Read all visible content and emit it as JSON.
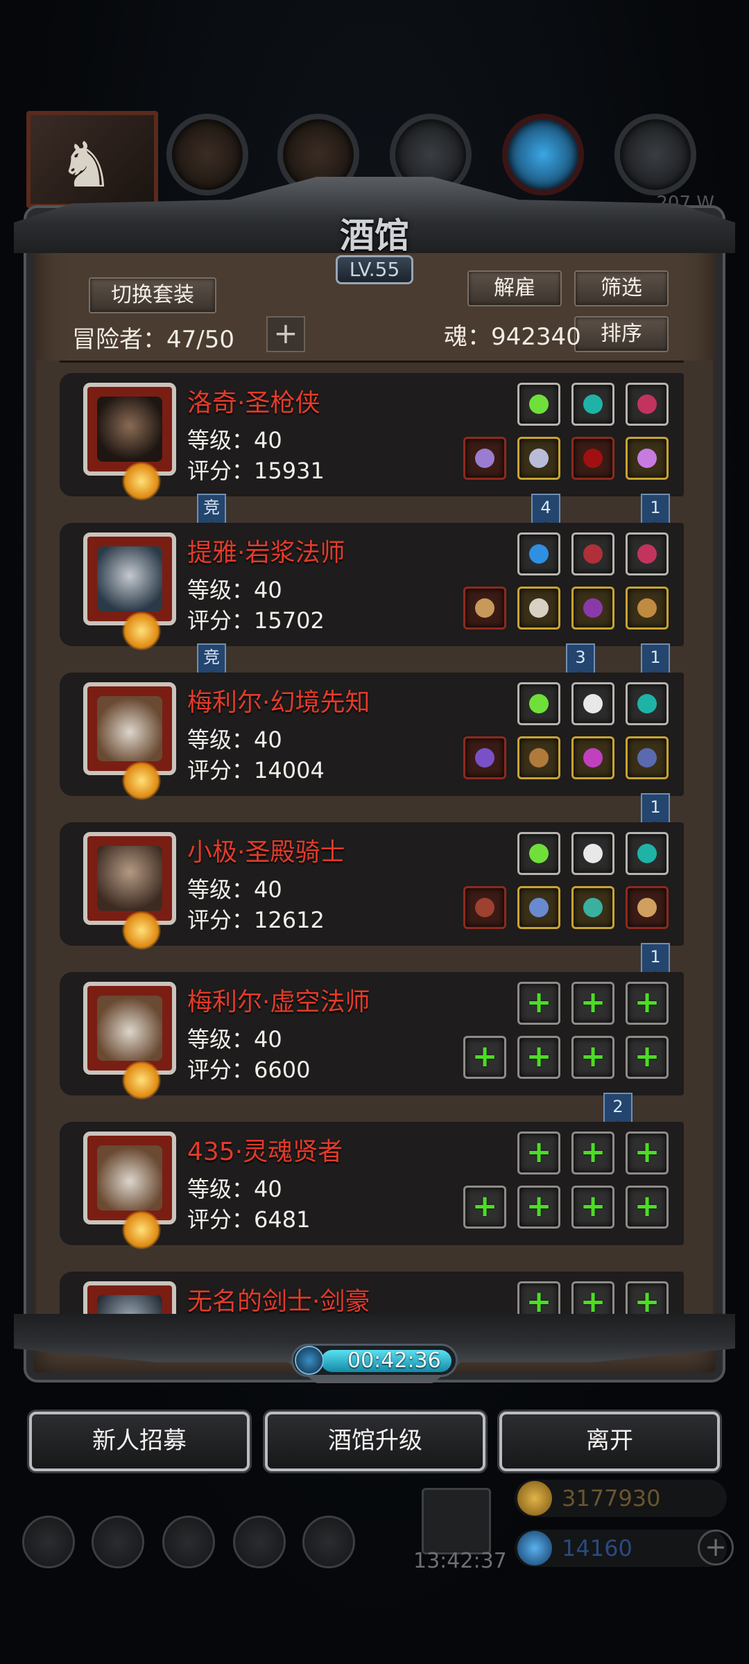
{
  "header": {
    "title": "酒馆",
    "level": "LV.55",
    "power_partial": "207.W"
  },
  "toolbar": {
    "switch_outfit": "切换套装",
    "dismiss": "解雇",
    "filter": "筛选",
    "sort": "排序",
    "adventurers_label": "冒险者：47/50",
    "soul_label": "魂：942340"
  },
  "heroes": [
    {
      "name": "洛奇·圣枪侠",
      "level": "等级：40",
      "score": "评分：15931",
      "flag_left": "竞",
      "flag_mid": "4",
      "flag_right": "1"
    },
    {
      "name": "提雅·岩浆法师",
      "level": "等级：40",
      "score": "评分：15702",
      "flag_left": "竞",
      "flag_mid": "3",
      "flag_right": "1"
    },
    {
      "name": "梅利尔·幻境先知",
      "level": "等级：40",
      "score": "评分：14004",
      "flag_right": "1"
    },
    {
      "name": "小极·圣殿骑士",
      "level": "等级：40",
      "score": "评分：12612",
      "flag_right": "1"
    },
    {
      "name": "梅利尔·虚空法师",
      "level": "等级：40",
      "score": "评分：6600",
      "flag_mid": "2"
    },
    {
      "name": "435·灵魂贤者",
      "level": "等级：40",
      "score": "评分：6481"
    },
    {
      "name": "无名的剑士·剑豪"
    }
  ],
  "timer": {
    "text": "00:42:36"
  },
  "actions": {
    "recruit": "新人招募",
    "upgrade": "酒馆升级",
    "leave": "离开"
  },
  "footer": {
    "gift_time": "13:42:37",
    "gold": "3177930",
    "gems": "14160"
  },
  "colors": {
    "hero_name": "#e23b2b",
    "add_slot": "#4cdd24",
    "timer_fill": "#38c4dc"
  }
}
